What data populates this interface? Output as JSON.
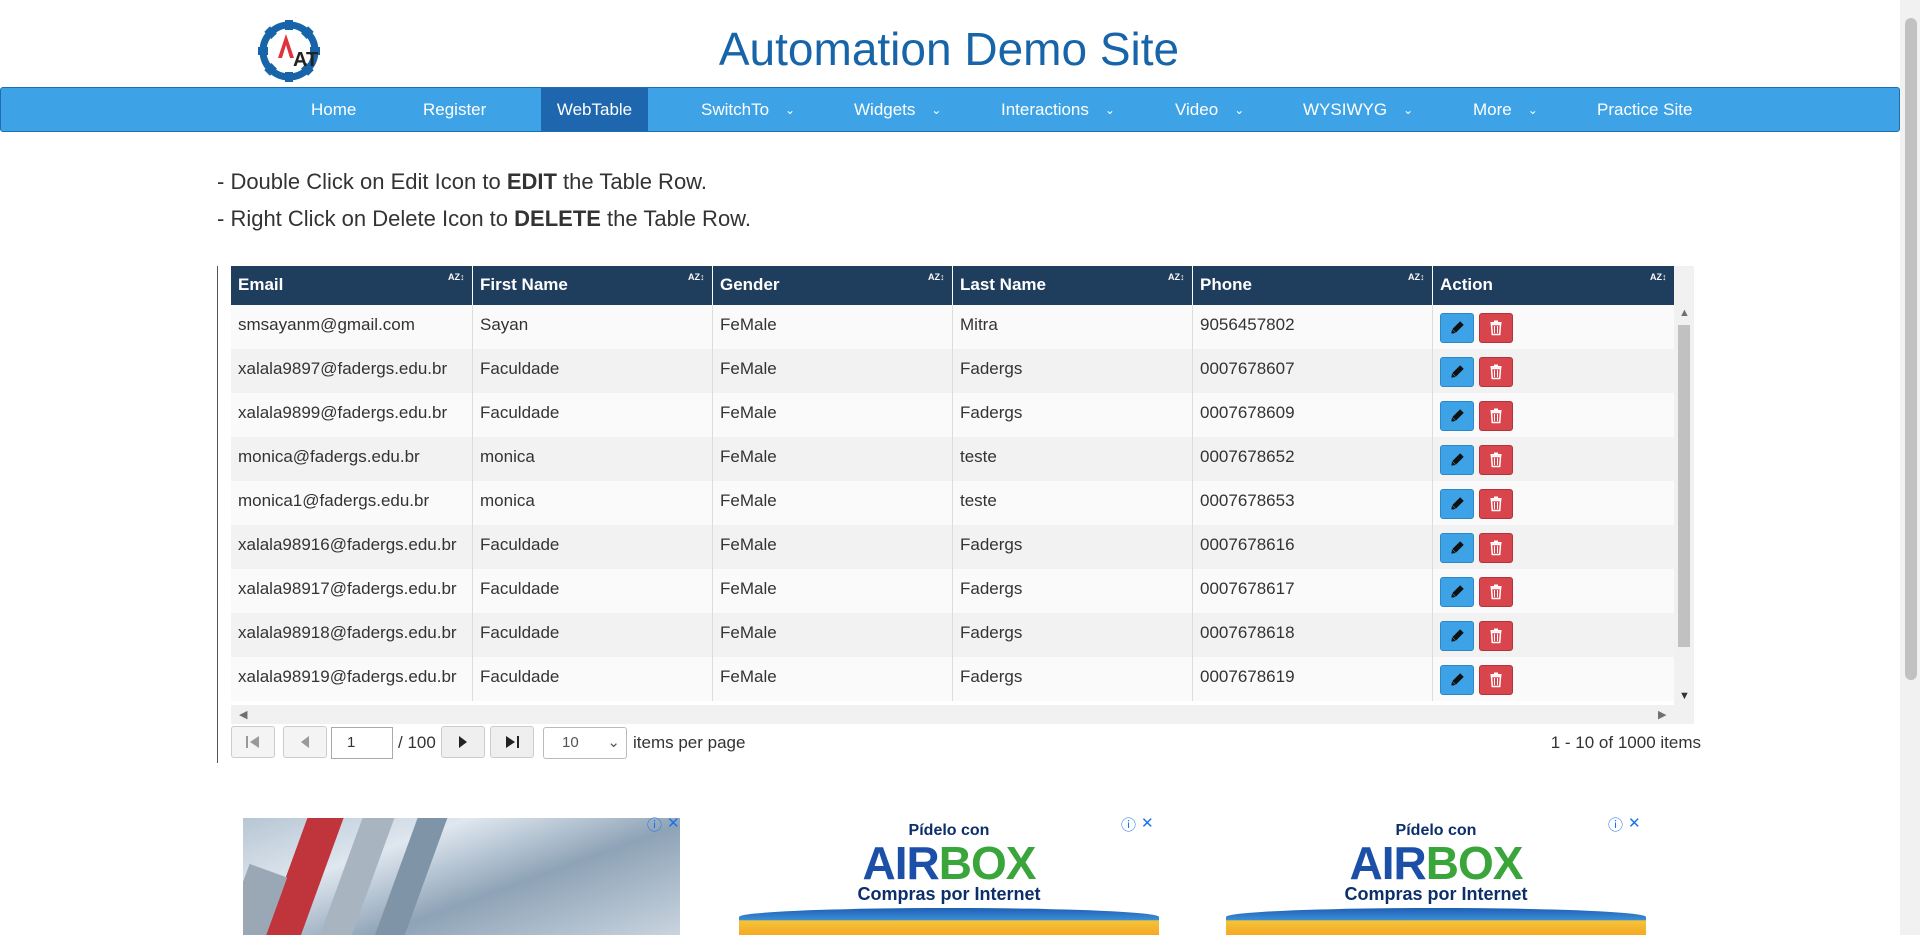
{
  "site": {
    "title": "Automation Demo Site",
    "logo_text": "AT"
  },
  "nav": {
    "items": [
      {
        "label": "Home",
        "has_dropdown": false,
        "active": false
      },
      {
        "label": "Register",
        "has_dropdown": false,
        "active": false
      },
      {
        "label": "WebTable",
        "has_dropdown": false,
        "active": true
      },
      {
        "label": "SwitchTo",
        "has_dropdown": true,
        "active": false
      },
      {
        "label": "Widgets",
        "has_dropdown": true,
        "active": false
      },
      {
        "label": "Interactions",
        "has_dropdown": true,
        "active": false
      },
      {
        "label": "Video",
        "has_dropdown": true,
        "active": false
      },
      {
        "label": "WYSIWYG",
        "has_dropdown": true,
        "active": false
      },
      {
        "label": "More",
        "has_dropdown": true,
        "active": false
      },
      {
        "label": "Practice Site",
        "has_dropdown": false,
        "active": false
      }
    ],
    "dropdown_glyph": "⌄"
  },
  "instructions": {
    "line1_prefix": "- Double Click on Edit Icon to ",
    "line1_bold": "EDIT",
    "line1_suffix": " the Table Row.",
    "line2_prefix": "- Right Click on Delete Icon to ",
    "line2_bold": "DELETE",
    "line2_suffix": " the Table Row."
  },
  "table": {
    "columns": [
      "Email",
      "First Name",
      "Gender",
      "Last Name",
      "Phone",
      "Action"
    ],
    "sort_icon": "AZ↕",
    "rows": [
      [
        "smsayanm@gmail.com",
        "Sayan",
        "FeMale",
        "Mitra",
        "9056457802"
      ],
      [
        "xalala9897@fadergs.edu.br",
        "Faculdade",
        "FeMale",
        "Fadergs",
        "0007678607"
      ],
      [
        "xalala9899@fadergs.edu.br",
        "Faculdade",
        "FeMale",
        "Fadergs",
        "0007678609"
      ],
      [
        "monica@fadergs.edu.br",
        "monica",
        "FeMale",
        "teste",
        "0007678652"
      ],
      [
        "monica1@fadergs.edu.br",
        "monica",
        "FeMale",
        "teste",
        "0007678653"
      ],
      [
        "xalala98916@fadergs.edu.br",
        "Faculdade",
        "FeMale",
        "Fadergs",
        "0007678616"
      ],
      [
        "xalala98917@fadergs.edu.br",
        "Faculdade",
        "FeMale",
        "Fadergs",
        "0007678617"
      ],
      [
        "xalala98918@fadergs.edu.br",
        "Faculdade",
        "FeMale",
        "Fadergs",
        "0007678618"
      ],
      [
        "xalala98919@fadergs.edu.br",
        "Faculdade",
        "FeMale",
        "Fadergs",
        "0007678619"
      ]
    ],
    "actions": {
      "edit_icon": "pencil-icon",
      "delete_icon": "trash-icon"
    }
  },
  "pager": {
    "current_page": "1",
    "total_pages": "/ 100",
    "page_size": "10",
    "items_per_page_label": "items per page",
    "summary": "1 - 10 of 1000 items"
  },
  "ads": {
    "ad2_line1": "Pídelo con",
    "ad2_brand_a": "AIR",
    "ad2_brand_b": "BOX",
    "ad2_line3": "Compras por Internet",
    "ad3_line1": "Pídelo con",
    "ad3_brand_a": "AIR",
    "ad3_brand_b": "BOX",
    "ad3_line3": "Compras por Internet",
    "info_glyph": "ⓘ",
    "close_glyph": "✕"
  },
  "colors": {
    "nav_bg": "#3ea3e6",
    "nav_active": "#1e66ae",
    "table_header": "#1f3d5c",
    "edit_button": "#3ea3e6",
    "delete_button": "#d9454d",
    "title": "#1765a8"
  }
}
